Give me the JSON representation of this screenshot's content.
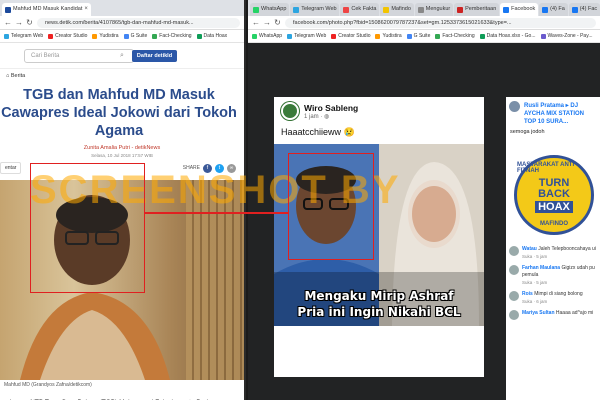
{
  "left_browser": {
    "tabs": [
      {
        "label": "Mahfud MD Masuk Kandidat",
        "active": true
      }
    ],
    "url": "news.detik.com/berita/4107865/tgb-dan-mahfud-md-masuk...",
    "bookmarks": [
      "Telegram Web",
      "Creator Studio",
      "Yudistira",
      "G Suite",
      "Fact-Checking",
      "Data Hoax"
    ],
    "search_placeholder": "Cari Berita",
    "daftar_label": "Daftar detikId",
    "crumb": "Berita",
    "headline": "TGB dan Mahfud MD Masuk Cawapres Ideal Jokowi dari Tokoh Agama",
    "author": "Zunita Amalia Putri - detikNews",
    "date": "Selasa, 10 Jul 2018 17:57 WIB",
    "komentar_label": "entar",
    "share_label": "SHARE",
    "caption": "Mahfud MD (Grandyos Zafna/detikcom)",
    "body": "ubernur NTB Tuan Guru Bajang (TGB) Muhammad Zainul nggota Badan Pembinaan Ideologi Pancasila (BPIP) Mahfud"
  },
  "watermark": "SCREENSHOT BY",
  "right_browser": {
    "tabs": [
      "WhatsApp",
      "Telegram Web",
      "Cek Fakta",
      "Mafindo",
      "Mengukur",
      "Pemberitaan",
      "Facebook",
      "(4) Fa",
      "(4) Fac"
    ],
    "url": "facebook.com/photo.php?fbid=1508620079787237&set=gm.1253373615021633&type=...",
    "bookmarks": [
      "WhatsApp",
      "Telegram Web",
      "Creator Studio",
      "Yudistira",
      "G Suite",
      "Fact-Checking",
      "Data Hoax.xlsx - Go...",
      "Waves-Zone - Pay..."
    ],
    "post": {
      "author": "Wiro Sableng",
      "time": "1 jam · ",
      "text": "Haaatcchiieww 😢",
      "meme_line1": "Mengaku Mirip Ashraf",
      "meme_line2": "Pria ini Ingin Nikahi BCL"
    },
    "comments_panel": {
      "top_user": "Rusli Pratama ▸ DJ AYCHA MIX STATION TOP 10 SURA...",
      "top_text": "semoga jodoh",
      "comments": [
        {
          "name": "Watau",
          "text": "Jaleh Telepbooncahaya ui",
          "meta": "Suka · 5 jam"
        },
        {
          "name": "Farhan Maulana",
          "text": "Gigizx udah pu pemula",
          "meta": "Suka · 5 jam"
        },
        {
          "name": "Rois",
          "text": "Mimpi di siang bolong",
          "meta": "Suka · 6 jam"
        },
        {
          "name": "Mariya Sultan",
          "text": "Haaaa ad^ajo mi",
          "meta": ""
        }
      ]
    },
    "stamp": {
      "line1": "TURN",
      "line2": "BACK",
      "line3": "HOAX",
      "ring_top": "MASYARAKAT ANTI FITNAH",
      "ring_bottom": "MAFINDO"
    }
  },
  "colors": {
    "detik_blue": "#2b4c8c",
    "author_red": "#c0392b",
    "facebook_blue": "#1877f2",
    "highlight_red": "#e02020",
    "stamp_yellow": "#f2c400"
  }
}
